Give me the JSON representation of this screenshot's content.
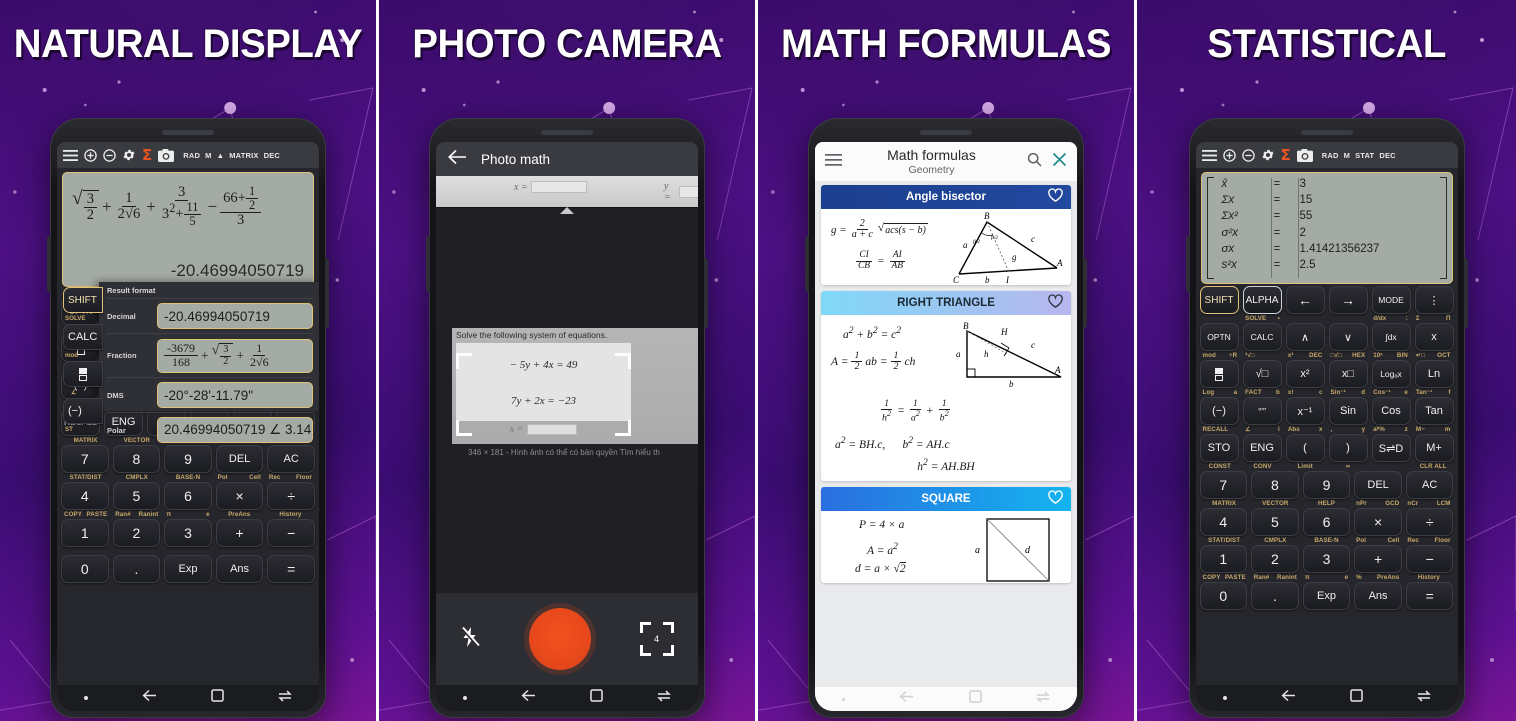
{
  "panels": [
    {
      "headline": "NATURAL DISPLAY",
      "app": "calculator-natural",
      "toolbar": {
        "icons": [
          "menu-icon",
          "zoom-in-icon",
          "zoom-out-icon",
          "gear-icon",
          "sigma-icon",
          "camera-icon"
        ],
        "flags": [
          "RAD",
          "M",
          "MATRIX",
          "DEC"
        ]
      },
      "display": {
        "expression_parts": [
          "sqrt(3/2)",
          "+",
          "1/(2*sqrt(6))",
          "+",
          "3/(3^2 + 11/5)",
          "-",
          "(66 + 1/2)/3"
        ],
        "result": "-20.46994050719"
      },
      "result_format": {
        "title": "Result format",
        "rows": [
          {
            "label": "Decimal",
            "value": "-20.46994050719"
          },
          {
            "label": "Fraction",
            "value": "-3679/168 + sqrt(3/2) + 1/(2 sqrt(6))"
          },
          {
            "label": "DMS",
            "value": "-20°-28'-11.79\""
          },
          {
            "label": "Polar",
            "value": "20.46994050719 ∠ 3.14"
          }
        ]
      },
      "partial_keys": [
        "SHIFT",
        "CALC",
        "frac",
        "(−)"
      ],
      "partial_key_subs": [
        "SOLVE",
        "mod",
        "∠",
        "ST"
      ]
    },
    {
      "headline": "PHOTO CAMERA",
      "app": "photo-camera",
      "appbar": {
        "back_icon": "back-arrow-icon",
        "title": "Photo math"
      },
      "web_strip": {
        "x_label": "x =",
        "y_label": "y ="
      },
      "photo": {
        "caption": "Solve the following system of equations.",
        "equation_1": "− 5y + 4x = 49",
        "equation_2": "7y + 2x = −23",
        "x_label": "x =",
        "meta": "346 × 181  -  Hình ảnh có thể có bản quyền   Tìm hiểu th"
      },
      "controls": {
        "flash_icon": "flash-off-icon",
        "shutter_icon": "shutter-button",
        "crop_icon": "crop-focus-icon",
        "crop_badge": "4"
      }
    },
    {
      "headline": "MATH FORMULAS",
      "app": "math-formulas",
      "appbar": {
        "menu_icon": "hamburger-menu-icon",
        "title": "Math formulas",
        "subtitle": "Geometry",
        "search_icon": "search-icon",
        "close_icon": "close-icon",
        "close_color": "#1f8a8a"
      },
      "cards": [
        {
          "title": "Angle bisector",
          "head_bg": "linear-gradient(90deg,#1d3f8f 0%, #21499e 100%)",
          "head_color": "#ffffff",
          "favorite_icon": "heart-icon",
          "formulas": [
            "g = 2/(a+c) · √(acs(s−b))",
            "CI/CB = AI/AB"
          ],
          "diagram": "triangle-angle-bisector",
          "diagram_labels": [
            "B",
            "a",
            "c",
            "g",
            "C",
            "b",
            "I",
            "A",
            "β/2",
            "β/2"
          ]
        },
        {
          "title": "RIGHT TRIANGLE",
          "head_bg": "linear-gradient(90deg,#7fd8f7 0%, #b8b6ee 100%)",
          "head_color": "#1b2a33",
          "favorite_icon": "heart-icon",
          "formulas": [
            "a² + b² = c²",
            "A = ½ ab = ½ ch",
            "1/h² = 1/a² + 1/b²",
            "a² = BH.c,      b² = AH.c",
            "h² = AH.BH"
          ],
          "diagram": "right-triangle",
          "diagram_labels": [
            "B",
            "H",
            "c",
            "a",
            "h",
            "A",
            "b"
          ]
        },
        {
          "title": "SQUARE",
          "head_bg": "linear-gradient(90deg,#2a6fe0 0%, #14b4ef 100%)",
          "head_color": "#ffffff",
          "favorite_icon": "heart-icon",
          "formulas": [
            "P = 4 × a",
            "A = a²",
            "d = a × √2"
          ],
          "diagram": "square-with-diagonal",
          "diagram_labels": [
            "a",
            "d"
          ]
        }
      ]
    },
    {
      "headline": "STATISTICAL",
      "app": "calculator-stat",
      "toolbar": {
        "icons": [
          "menu-icon",
          "zoom-in-icon",
          "zoom-out-icon",
          "gear-icon",
          "sigma-icon",
          "camera-icon"
        ],
        "flags": [
          "RAD",
          "M",
          "STAT",
          "DEC"
        ]
      },
      "stat_rows": [
        {
          "symbol": "x̄",
          "eq": "=",
          "value": "3"
        },
        {
          "symbol": "Σx",
          "eq": "=",
          "value": "15"
        },
        {
          "symbol": "Σx²",
          "eq": "=",
          "value": "55"
        },
        {
          "symbol": "σ²x",
          "eq": "=",
          "value": "2"
        },
        {
          "symbol": "σx",
          "eq": "=",
          "value": "1.41421356237"
        },
        {
          "symbol": "s²x",
          "eq": "=",
          "value": "2.5"
        }
      ]
    }
  ],
  "keypad": {
    "row_fn1": {
      "keys": [
        "SHIFT",
        "ALPHA",
        "←",
        "→",
        "MODE",
        "⋮"
      ],
      "subs": [
        {
          "left": "",
          "right": ""
        },
        {
          "left": "SOLVE",
          "right": "▪"
        },
        {
          "left": "",
          "right": ""
        },
        {
          "left": "",
          "right": ""
        },
        {
          "left": "d/dx",
          "right": ":"
        },
        {
          "left": "Σ",
          "right": "Π"
        }
      ]
    },
    "row_fn2": {
      "keys": [
        "OPTN",
        "CALC",
        "∧",
        "∨",
        "∫dx",
        "x"
      ],
      "subs": [
        {
          "left": "mod",
          "right": "÷R"
        },
        {
          "left": "³√□",
          "right": ""
        },
        {
          "left": "x³",
          "right": "DEC"
        },
        {
          "left": "□√□",
          "right": "HEX"
        },
        {
          "left": "10ˣ",
          "right": "BIN"
        },
        {
          "left": "↵□",
          "right": "OCT"
        }
      ]
    },
    "row_fn3": {
      "keys": [
        "FRAC",
        "√□",
        "x²",
        "x□",
        "Logₐx",
        "Ln"
      ],
      "subs": [
        {
          "left": "Log",
          "right": "a"
        },
        {
          "left": "FACT",
          "right": "b"
        },
        {
          "left": "x!",
          "right": "c"
        },
        {
          "left": "Sin⁻¹",
          "right": "d"
        },
        {
          "left": "Cos⁻¹",
          "right": "e"
        },
        {
          "left": "Tan⁻¹",
          "right": "f"
        }
      ]
    },
    "row_fn4": {
      "keys": [
        "(−)",
        "°′″",
        "x⁻¹",
        "Sin",
        "Cos",
        "Tan"
      ],
      "subs": [
        {
          "left": "RECALL",
          "right": ""
        },
        {
          "left": "∠",
          "right": "i"
        },
        {
          "left": "Abs",
          "right": "x"
        },
        {
          "left": ",",
          "right": "y"
        },
        {
          "left": "aᵇ%",
          "right": "z"
        },
        {
          "left": "M−",
          "right": "m"
        }
      ]
    },
    "row_fn5": {
      "keys": [
        "STO",
        "ENG",
        "(",
        ")",
        "S⇌D",
        "M+"
      ],
      "subs": [
        {
          "left": "CONST",
          "right": ""
        },
        {
          "left": "CONV",
          "right": ""
        },
        {
          "left": "Limit",
          "right": ""
        },
        {
          "left": "∞",
          "right": ""
        },
        {
          "left": "",
          "right": ""
        },
        {
          "left": "CLR ALL",
          "right": ""
        }
      ]
    },
    "row_fn5_alt": {
      "keys": [
        "RECALL",
        "ENG",
        "(",
        ")",
        "S⇌D",
        "M+"
      ]
    },
    "num_rows": [
      {
        "keys": [
          "7",
          "8",
          "9",
          "DEL",
          "AC"
        ],
        "subs": [
          {
            "left": "MATRIX",
            "right": ""
          },
          {
            "left": "VECTOR",
            "right": ""
          },
          {
            "left": "HELP",
            "right": ""
          },
          {
            "left": "nPr",
            "right": "GCD"
          },
          {
            "left": "nCr",
            "right": "LCM"
          }
        ]
      },
      {
        "keys": [
          "4",
          "5",
          "6",
          "×",
          "÷"
        ],
        "subs": [
          {
            "left": "STAT/DIST",
            "right": ""
          },
          {
            "left": "CMPLX",
            "right": ""
          },
          {
            "left": "BASE-N",
            "right": ""
          },
          {
            "left": "Pol",
            "right": "Cell"
          },
          {
            "left": "Rec",
            "right": "Floor"
          }
        ]
      },
      {
        "keys": [
          "1",
          "2",
          "3",
          "+",
          "−"
        ],
        "subs": [
          {
            "left": "COPY",
            "right": "PASTE"
          },
          {
            "left": "Ran#",
            "right": "Ranint"
          },
          {
            "left": "π",
            "right": "e"
          },
          {
            "left": "%",
            "right": "PreAns"
          },
          {
            "left": "History",
            "right": ""
          }
        ]
      },
      {
        "keys": [
          "0",
          ".",
          "Exp",
          "Ans",
          "="
        ],
        "subs": [
          {
            "left": "",
            "right": ""
          },
          {
            "left": "",
            "right": ""
          },
          {
            "left": "",
            "right": ""
          },
          {
            "left": "",
            "right": ""
          },
          {
            "left": "",
            "right": ""
          }
        ]
      }
    ]
  },
  "navbar": {
    "icons": [
      "dot-indicator",
      "back-arrow-icon",
      "square-recents-icon",
      "switch-icon"
    ]
  },
  "colors": {
    "accent_orange": "#ec5322",
    "lcd_bg": "#a4aaa4",
    "lcd_border": "#e0c278",
    "bg_purple": "#4c1083",
    "bg_magenta": "#9b1f8f"
  }
}
